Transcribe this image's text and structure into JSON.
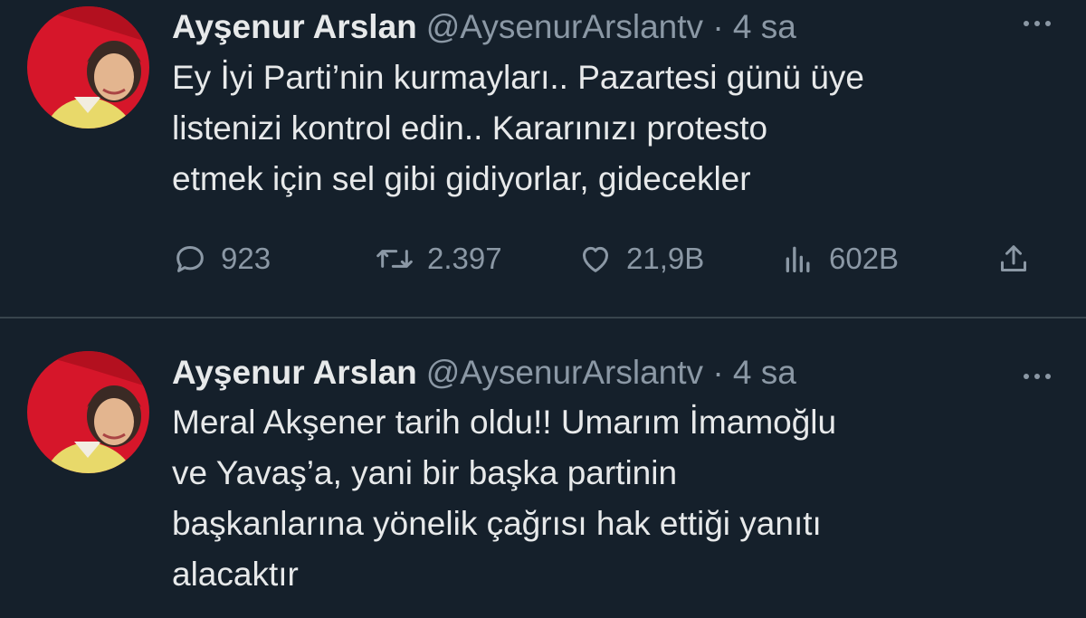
{
  "tweets": [
    {
      "author": {
        "name": "Ayşenur Arslan",
        "handle": "@AysenurArslantv"
      },
      "separator": "·",
      "time": "4 sa",
      "lines": [
        "Ey İyi Parti’nin kurmayları.. Pazartesi günü üye",
        "listenizi kontrol edin.. Kararınızı protesto",
        "etmek için sel gibi gidiyorlar, gidecekler"
      ],
      "actions": {
        "replies": "923",
        "retweets": "2.397",
        "likes": "21,9B",
        "views": "602B"
      }
    },
    {
      "author": {
        "name": "Ayşenur Arslan",
        "handle": "@AysenurArslantv"
      },
      "separator": "·",
      "time": "4 sa",
      "lines": [
        "Meral Akşener tarih oldu!! Umarım İmamoğlu",
        "ve Yavaş’a, yani bir başka partinin",
        "başkanlarına yönelik çağrısı hak ettiği yanıtı",
        "alacaktır"
      ]
    }
  ],
  "icons": {
    "more": "more-dots-icon",
    "reply": "reply-bubble-icon",
    "retweet": "retweet-icon",
    "like": "heart-icon",
    "views": "views-bar-chart-icon",
    "share": "share-upload-icon"
  },
  "colors": {
    "background": "#15202b",
    "text": "#e7e9ea",
    "secondary": "#8b98a5",
    "divider": "#38444d"
  }
}
